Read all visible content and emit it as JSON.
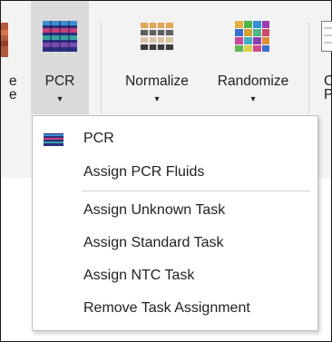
{
  "ribbon": {
    "left_partial_label": "e",
    "left_partial_label_2": "e",
    "buttons": [
      {
        "label": "PCR",
        "arrow": "▾"
      },
      {
        "label": "Normalize",
        "arrow": "▾"
      },
      {
        "label": "Randomize",
        "arrow": "▾"
      }
    ],
    "right_partial_label_1": "C",
    "right_partial_label_2": "P"
  },
  "menu": {
    "items": [
      {
        "label": "PCR",
        "icon": "pcr-plate-icon"
      },
      {
        "label": "Assign PCR Fluids"
      },
      {
        "label": "Assign Unknown Task"
      },
      {
        "label": "Assign Standard Task"
      },
      {
        "label": "Assign NTC Task"
      },
      {
        "label": "Remove Task Assignment"
      }
    ]
  },
  "colors": {
    "ribbon_bg": "#f3f3f3",
    "active_button_bg": "#dadada",
    "menu_bg": "#ffffff"
  }
}
